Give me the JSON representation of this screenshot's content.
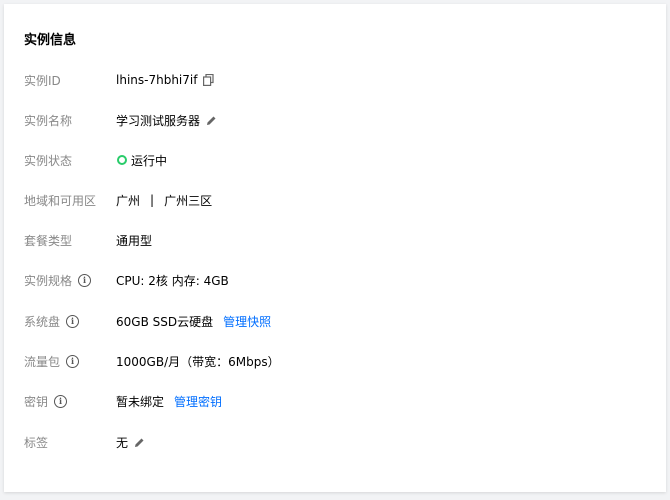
{
  "panel": {
    "title": "实例信息"
  },
  "rows": {
    "instance_id": {
      "label": "实例ID",
      "value": "lhins-7hbhi7if",
      "copy_icon": "copy-icon"
    },
    "instance_name": {
      "label": "实例名称",
      "value": "学习测试服务器",
      "edit_icon": "pencil-icon"
    },
    "instance_status": {
      "label": "实例状态",
      "value": "运行中",
      "status_color": "#29cc6a"
    },
    "region": {
      "label": "地域和可用区",
      "region": "广州",
      "separator": "|",
      "zone": "广州三区"
    },
    "package_type": {
      "label": "套餐类型",
      "value": "通用型"
    },
    "spec": {
      "label": "实例规格",
      "value": "CPU: 2核 内存: 4GB",
      "info_icon": "info-icon"
    },
    "system_disk": {
      "label": "系统盘",
      "value": "60GB SSD云硬盘",
      "link": "管理快照",
      "info_icon": "info-icon"
    },
    "traffic": {
      "label": "流量包",
      "value": "1000GB/月（带宽：6Mbps）",
      "info_icon": "info-icon"
    },
    "key": {
      "label": "密钥",
      "value": "暂未绑定",
      "link": "管理密钥",
      "info_icon": "info-icon"
    },
    "tags": {
      "label": "标签",
      "value": "无",
      "edit_icon": "pencil-icon"
    }
  },
  "colors": {
    "link": "#006eff",
    "label": "#888888",
    "status_running": "#29cc6a"
  }
}
